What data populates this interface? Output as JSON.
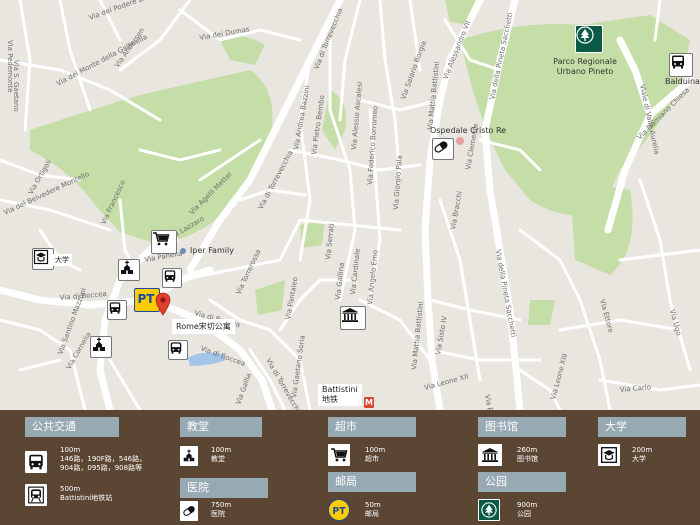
{
  "map": {
    "place_labels": {
      "iper_family": "Iper Family",
      "ospedale": "Ospedale Cristo Re",
      "parco": [
        "Parco Regionale",
        "Urbano Pineto"
      ],
      "balduina": "Balduina",
      "univ_short": "大学",
      "apartment": "Rome宋切公寓",
      "battistini": "Battistini",
      "battistini_sub": "地铁",
      "metro_m": "M"
    },
    "roads": {
      "v_del_podere_zara": "Via del Podere Zara",
      "v_pedemonte": "Via Pedemonte",
      "v_anderson": "Via Andersen",
      "v_monte_gallinella": "Via del Monte della Gallinella",
      "v_duimas": "Via dei Dumas",
      "v_torrevecchia": "Via di Torrevecchia",
      "v_torrevecchia2": "Via di Torrevecchia",
      "v_battistini": "Via Mattia Battistini",
      "v_battistini2": "Via Mattia Battistini",
      "v_pineta": "Via della Pineta Sacchetti",
      "v_pineta2": "Via della Pineta Sacchetti",
      "v_boccea": "Via di Boccea",
      "v_boccea2": "Via di Boccea",
      "v_boccea3": "Via di Boccea",
      "v_aurelia": "Viale di Valle Aurelia",
      "v_chiesa": "Via Damiano Chiesa",
      "v_gaetano": "Via S. Gaetano",
      "v_montebello": "Via del Belvedere Montello",
      "v_ortigoli": "Via Ortigoli",
      "v_corne": "Via Cornelia",
      "v_mazzoni": "Via Santino Mazzoni",
      "v_lazzaro": "Via Lazzaro",
      "v_agelli": "Via Agelli Mettel",
      "v_francesco": "Via Francesco",
      "v_panella": "Via Panella",
      "v_buffalini": "Via Buffalini",
      "v_pietro": "Via Pietro Bembo",
      "v_bazzini": "Via Andrea Bazzini",
      "v_ascaroni": "Via Alessio Ascalesi",
      "v_borromeo": "Via Federico Borromeo",
      "v_giorgio": "Via Giorgio Pala",
      "v_salario": "Via Salario Borgia",
      "v_alessandro": "Via Alessandro VII",
      "v_clemente": "Via Clemente",
      "v_bracchi": "Via Bracchi",
      "v_martino": "Via Martino V",
      "v_leone": "Via Leone XII",
      "v_sisto": "Via Sisto IV",
      "v_innocenzo": "Via Innocenzo",
      "v_ammoniti": "Via Ammoniti",
      "v_gallina": "Via Gallina",
      "v_oriolo": "Via Oriolo",
      "v_cardinale": "Via Cardinale",
      "v_angelo": "Via Angelo Emo",
      "v_lazzaro2": "Via Lazzaro",
      "v_soria": "Via Gaetano Soria",
      "v_cirenei": "Via Cirenei",
      "v_pantaleo": "Via Pantaleo",
      "v_vincenzo": "Via Vincenzo",
      "v_torrevecchia_low": "Via di Torrevecchia",
      "v_torrerossa": "Via Torrerossa",
      "v_bottari": "Via Bottari",
      "v_gallia": "Via Gallia",
      "v_leone13": "Via Leone XIII",
      "v_boccea_low": "Via di Boccea",
      "v_ettore": "Via Ettore",
      "v_ugo": "Via Ugo",
      "v_serrati": "Via Serrati",
      "v_soprano": "Via Soprano",
      "v_carlo": "Via Carlo",
      "v_pio": "Via Pio"
    }
  },
  "legend": {
    "transit": {
      "title": "公共交通",
      "bus_dist": "100m",
      "bus_lines": [
        "146路，190F路，546路，",
        "904路，095路，908路等"
      ],
      "metro_dist": "500m",
      "metro_name": "Battistini地铁站"
    },
    "church": {
      "title": "教堂",
      "dist": "100m",
      "name": "教堂"
    },
    "hospital": {
      "title": "医院",
      "dist": "750m",
      "name": "医院"
    },
    "supermarket": {
      "title": "超市",
      "dist": "100m",
      "name": "超市"
    },
    "post": {
      "title": "邮局",
      "dist": "50m",
      "name": "邮局"
    },
    "library": {
      "title": "图书馆",
      "dist": "260m",
      "name": "图书馆"
    },
    "park": {
      "title": "公园",
      "dist": "900m",
      "name": "公园"
    },
    "university": {
      "title": "大学",
      "dist": "200m",
      "name": "大学"
    }
  },
  "icons": {
    "bus": "bus-icon",
    "metro": "metro-train-icon",
    "church": "church-icon",
    "hospital": "pill-icon",
    "supermarket": "shopping-cart-icon",
    "post": "pt-post-icon",
    "library": "library-building-icon",
    "park": "tree-icon",
    "university": "university-icon",
    "pin": "location-pin-icon"
  },
  "colors": {
    "legend_bg": "#5b4633",
    "category_header": "#97a9b2",
    "park_green": "#c5dda6",
    "road": "#ffffff",
    "land": "#e9e6df",
    "pin": "#e04030",
    "metro": "#d94836",
    "post_yellow": "#ffcc00",
    "post_blue": "#1a4a9e"
  }
}
